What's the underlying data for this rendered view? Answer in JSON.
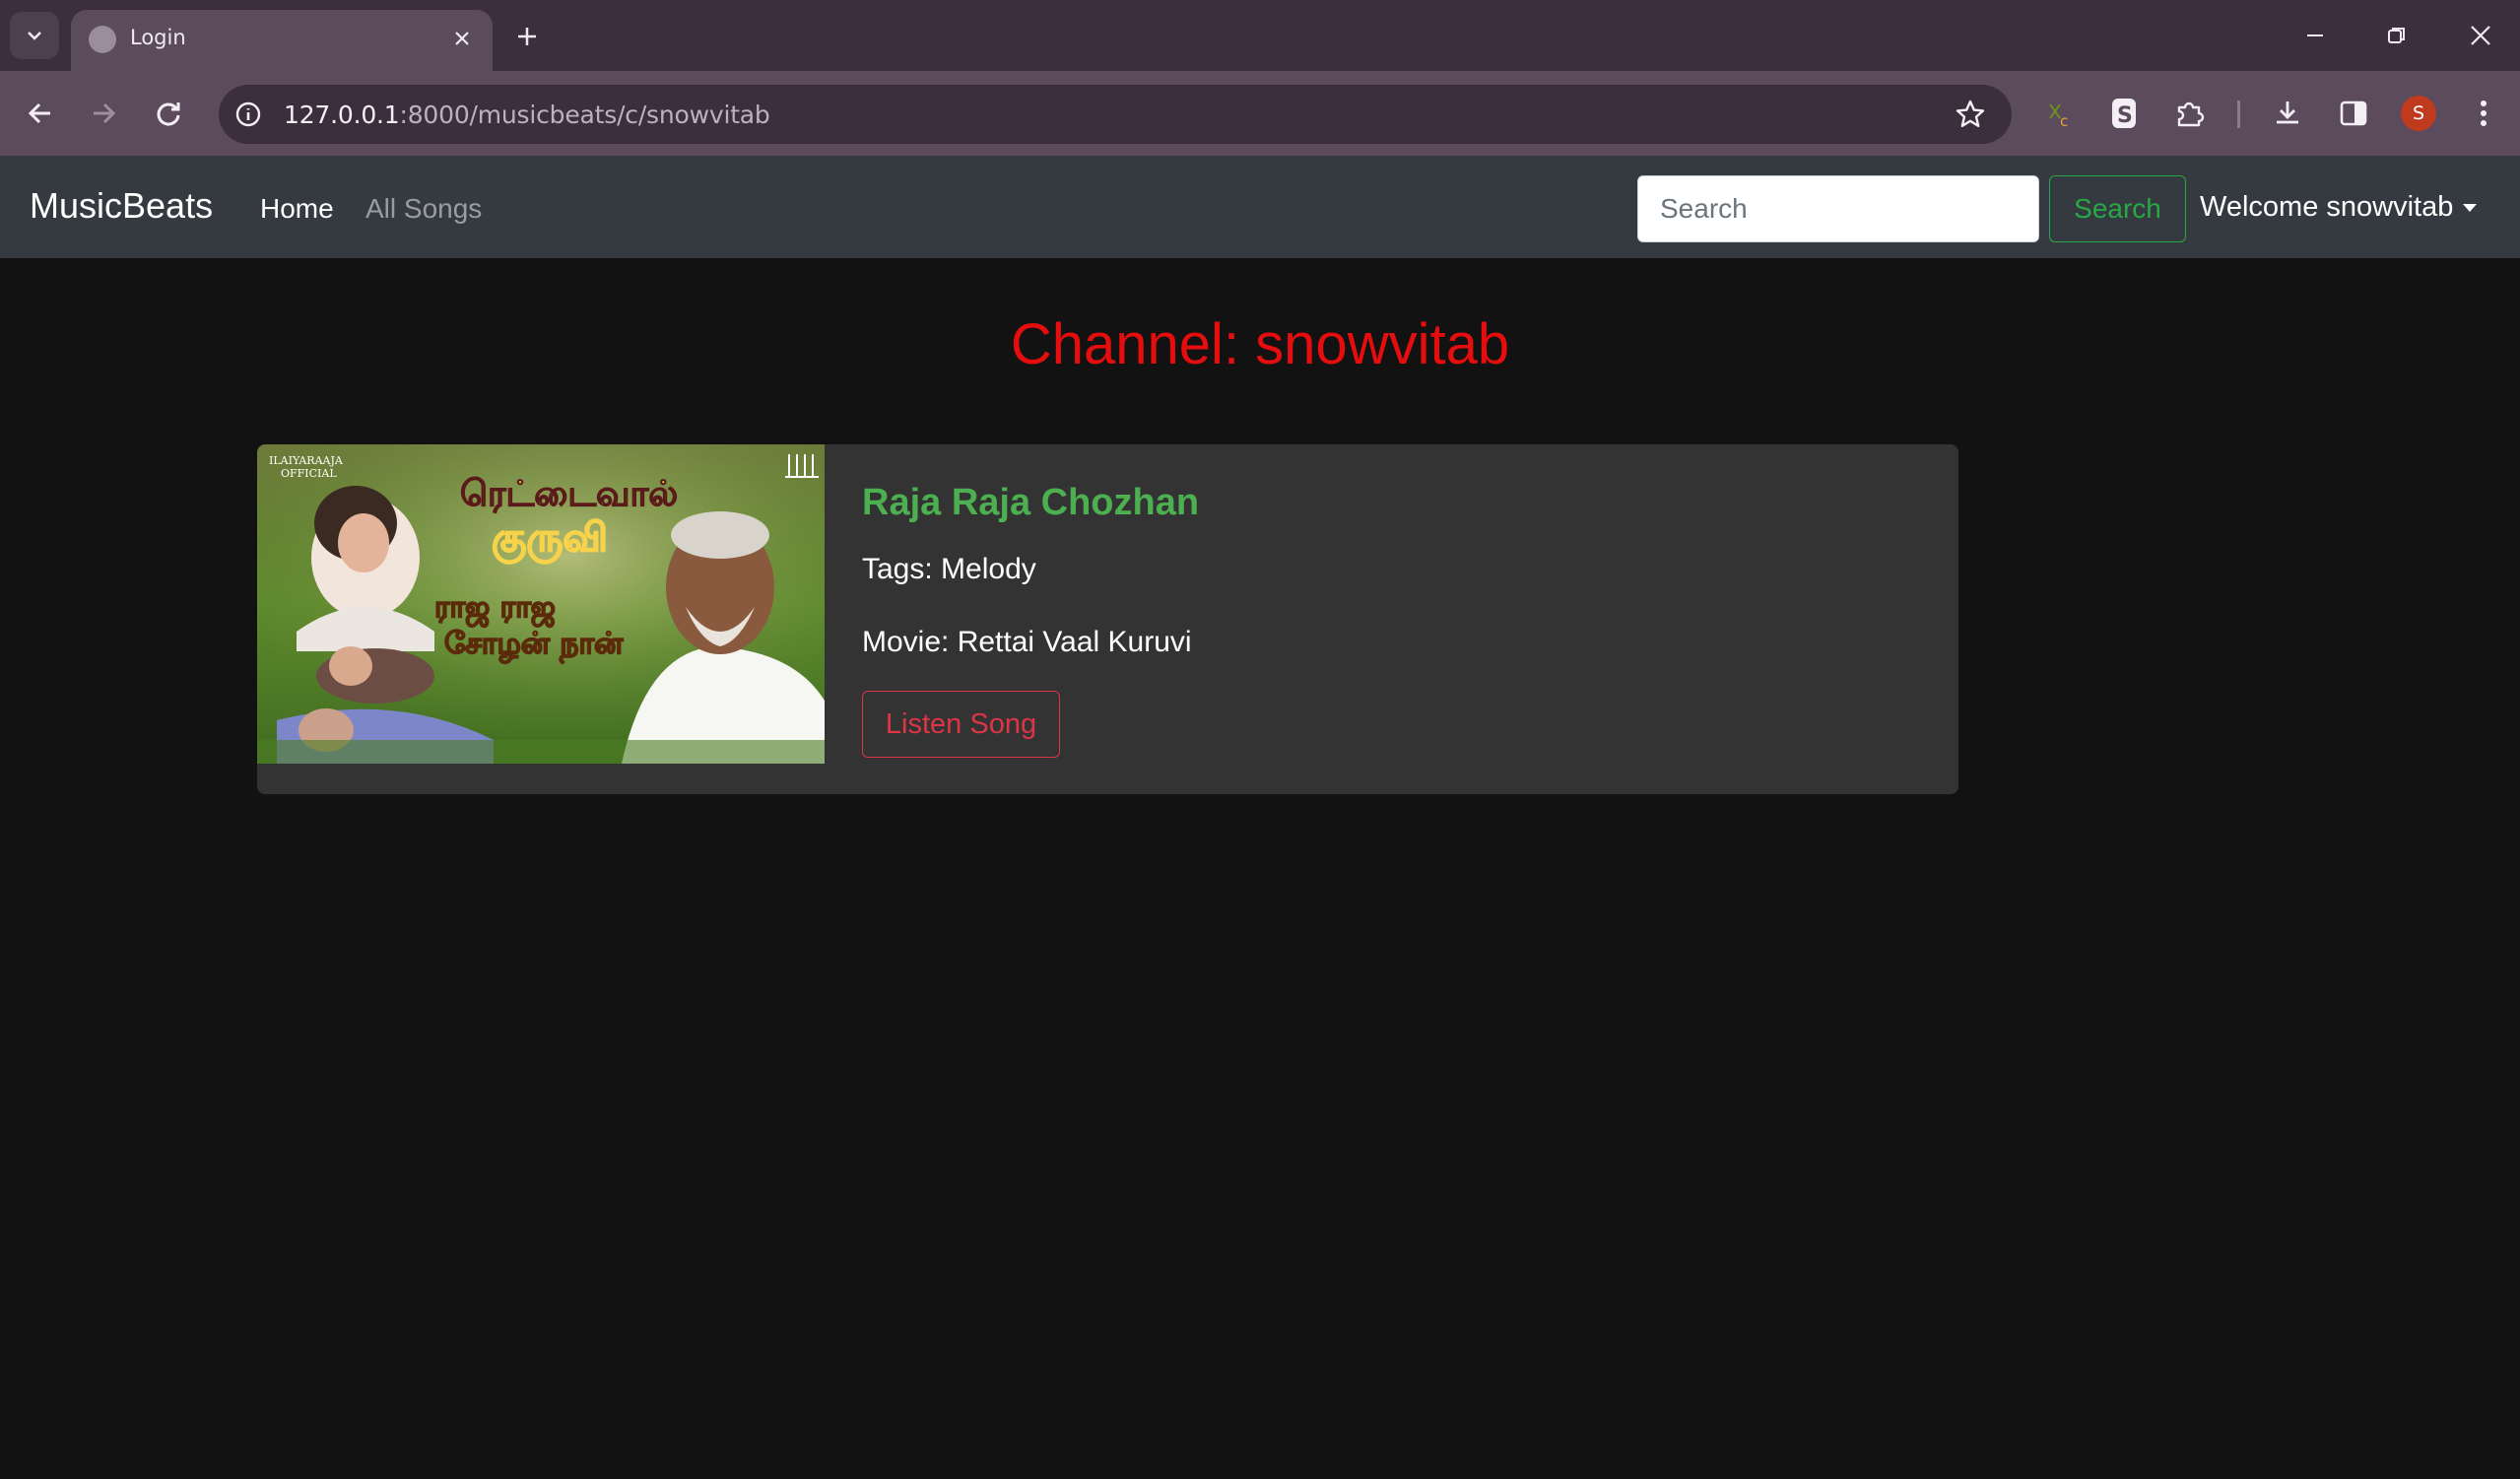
{
  "browser": {
    "tab_title": "Login",
    "url_host": "127.0.0.1",
    "url_rest": ":8000/musicbeats/c/snowvitab",
    "profile_initial": "S"
  },
  "navbar": {
    "brand": "MusicBeats",
    "links": [
      "Home",
      "All Songs"
    ],
    "search_placeholder": "Search",
    "search_button": "Search",
    "welcome": "Welcome snowvitab"
  },
  "page": {
    "heading": "Channel: snowvitab"
  },
  "song": {
    "title": "Raja Raja Chozhan",
    "tags": "Tags: Melody",
    "movie": "Movie: Rettai Vaal Kuruvi",
    "button": "Listen Song",
    "thumb_label_top": "ILAIYARAAJA",
    "thumb_label_bottom": "OFFICIAL",
    "thumb_tamil_1": "ரெட்டைவால்",
    "thumb_tamil_2": "குருவி",
    "thumb_tamil_3": "ராஜ ராஜ",
    "thumb_tamil_4": "சோழன் நான்"
  },
  "colors": {
    "page_bg": "#121212",
    "navbar_bg": "#343a40",
    "heading": "#e50d0d",
    "song_title": "#4caf50",
    "search_btn": "#28a745",
    "listen_btn": "#dc3545"
  }
}
